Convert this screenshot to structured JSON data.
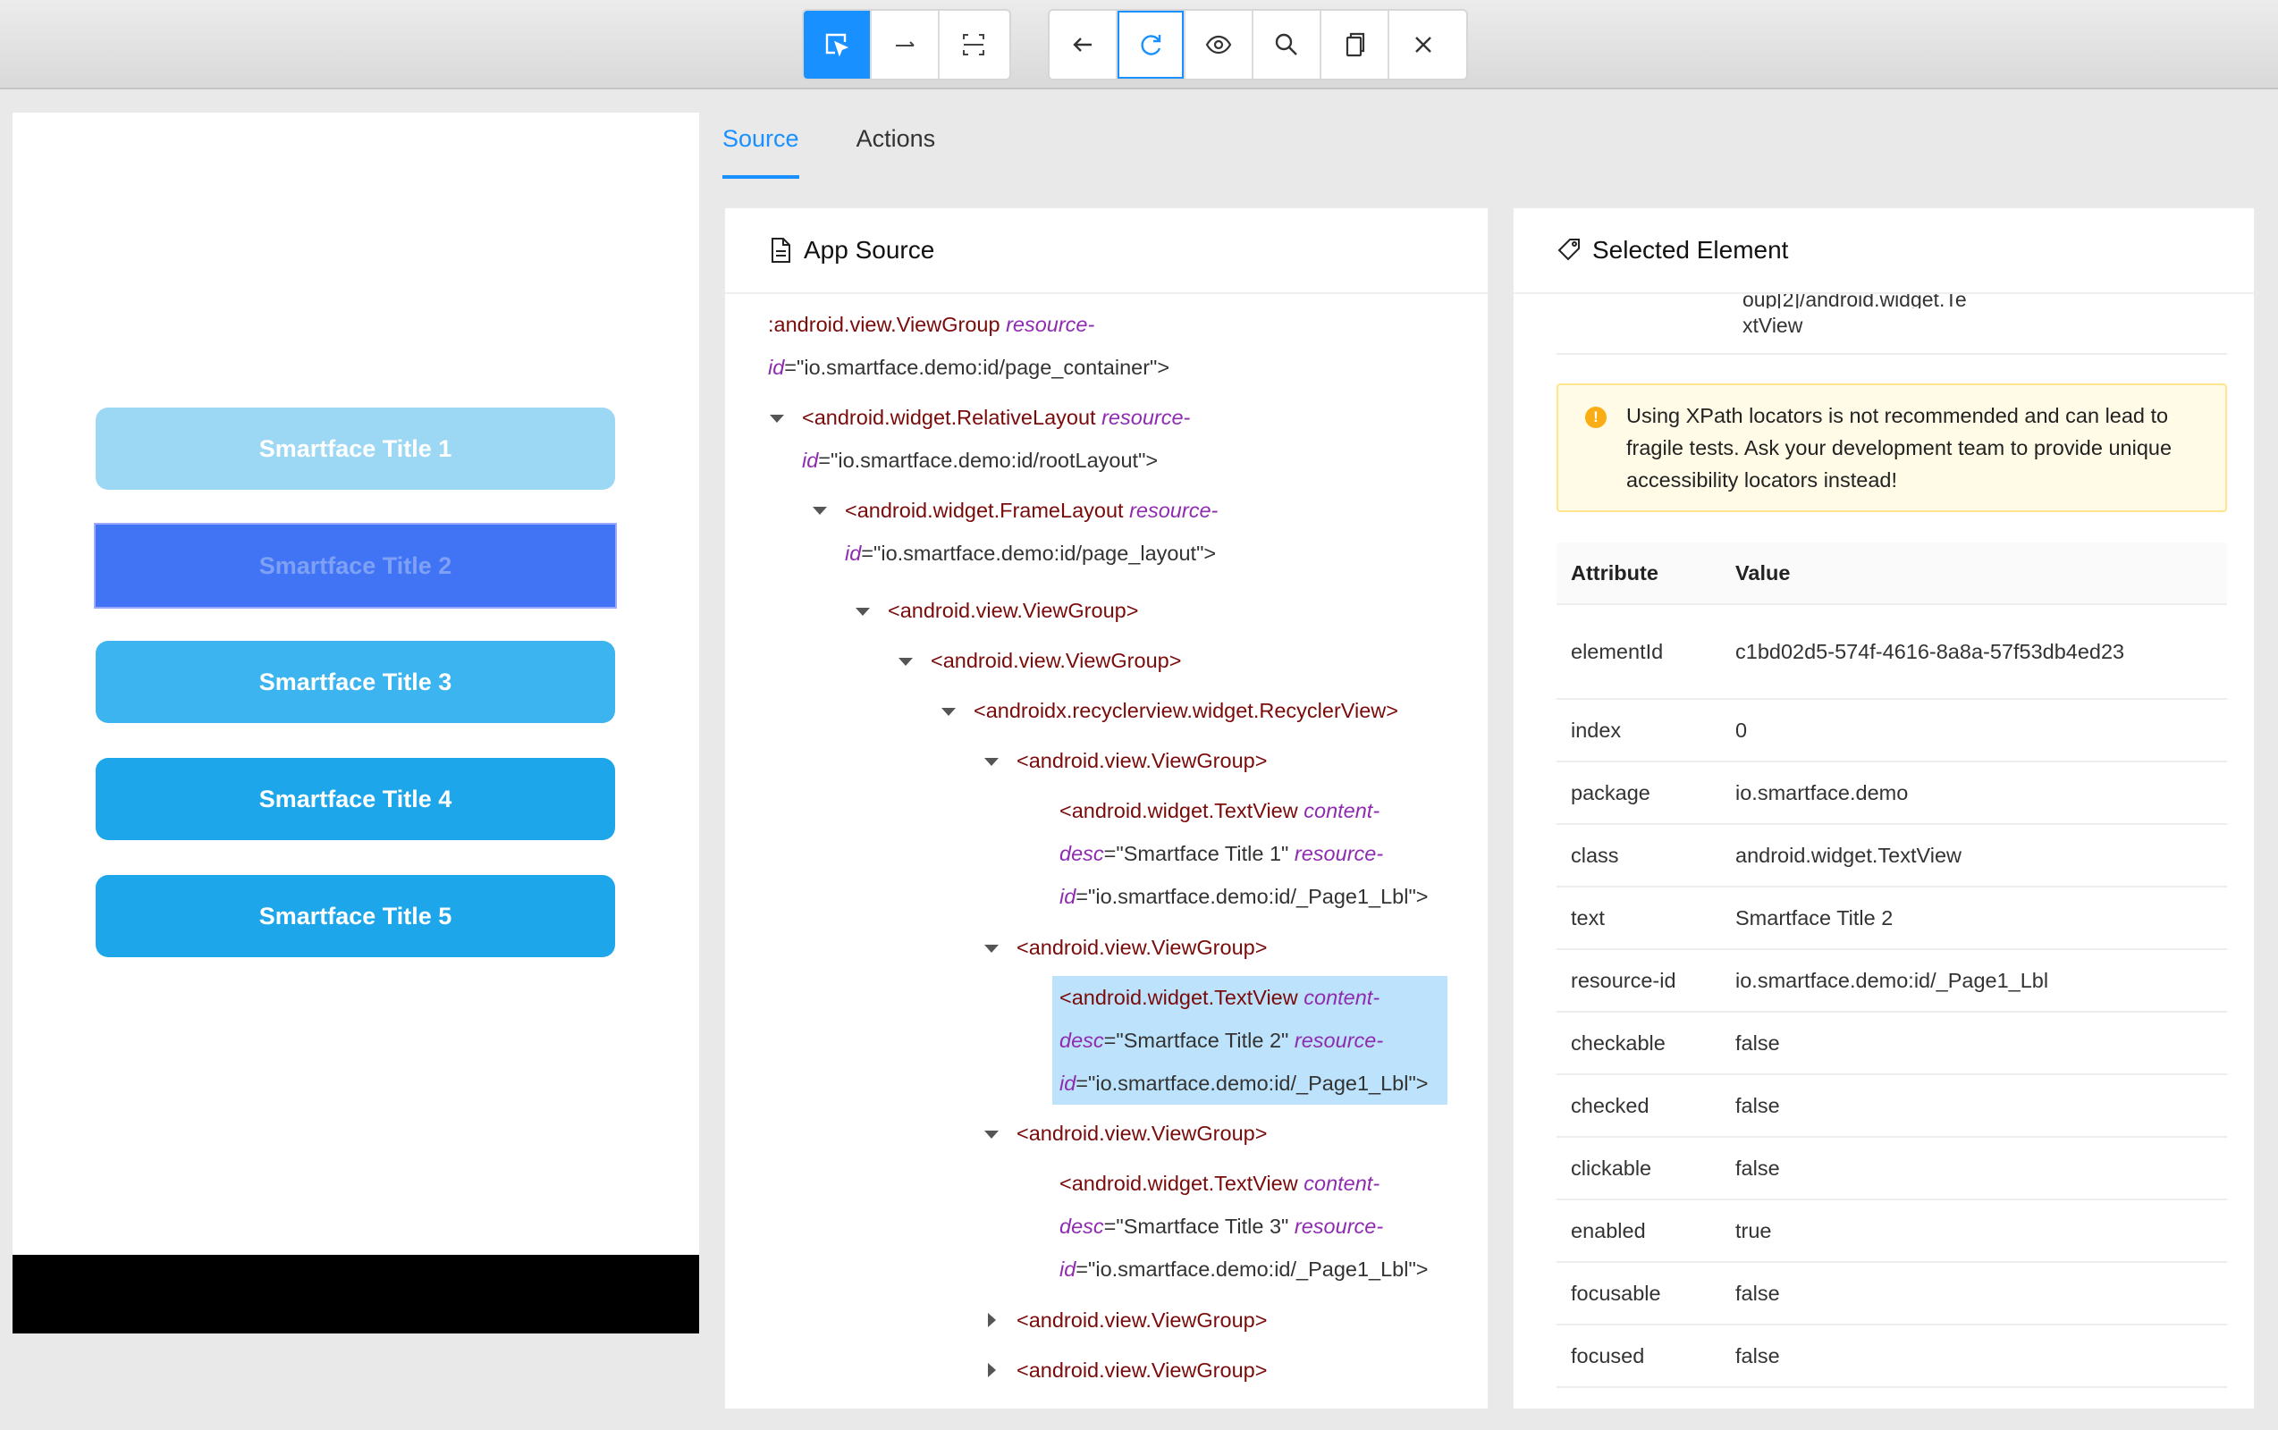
{
  "toolbar": {
    "group1": [
      {
        "icon": "select-element-icon",
        "active": true
      },
      {
        "icon": "swipe-icon"
      },
      {
        "icon": "tap-by-coordinates-icon"
      }
    ],
    "group2": [
      {
        "icon": "back-arrow-icon"
      },
      {
        "icon": "refresh-icon"
      },
      {
        "icon": "eye-icon"
      },
      {
        "icon": "search-icon"
      },
      {
        "icon": "copy-xml-icon"
      },
      {
        "icon": "close-icon"
      }
    ],
    "accent": "#1890ff"
  },
  "device": {
    "buttons": [
      "Smartface Title 1",
      "Smartface Title 2",
      "Smartface Title 3",
      "Smartface Title 4",
      "Smartface Title 5"
    ]
  },
  "tabs": {
    "source": "Source",
    "actions": "Actions"
  },
  "app_source": {
    "title": "App Source",
    "n0": {
      "tag": ":android.view.ViewGroup",
      "attr1": "resource-",
      "attr1b": "id",
      "val1": "=\"io.smartface.demo:id/page_container\">"
    },
    "n1": {
      "tag": "<android.widget.RelativeLayout",
      "attr1": "resource-",
      "attr1b": "id",
      "val1": "=\"io.smartface.demo:id/rootLayout\">"
    },
    "n2": {
      "tag": "<android.widget.FrameLayout",
      "attr1": "resource-",
      "attr1b": "id",
      "val1": "=\"io.smartface.demo:id/page_layout\">"
    },
    "n3": {
      "tag": "<android.view.ViewGroup>"
    },
    "n4": {
      "tag": "<android.view.ViewGroup>"
    },
    "n5": {
      "tag": "<androidx.recyclerview.widget.RecyclerView>"
    },
    "n6": {
      "tag": "<android.view.ViewGroup>"
    },
    "n7": {
      "tag": "<android.widget.TextView",
      "attr1": "content-",
      "attr1b": "desc",
      "val1": "=\"Smartface Title 1\"",
      "attr2": "resource-",
      "attr2b": "id",
      "val2": "=\"io.smartface.demo:id/_Page1_Lbl\">"
    },
    "n8": {
      "tag": "<android.view.ViewGroup>"
    },
    "n9": {
      "tag": "<android.widget.TextView",
      "attr1": "content-",
      "attr1b": "desc",
      "val1": "=\"Smartface Title 2\"",
      "attr2": "resource-",
      "attr2b": "id",
      "val2": "=\"io.smartface.demo:id/_Page1_Lbl\">"
    },
    "n10": {
      "tag": "<android.view.ViewGroup>"
    },
    "n11": {
      "tag": "<android.widget.TextView",
      "attr1": "content-",
      "attr1b": "desc",
      "val1": "=\"Smartface Title 3\"",
      "attr2": "resource-",
      "attr2b": "id",
      "val2": "=\"io.smartface.demo:id/_Page1_Lbl\">"
    },
    "n12": {
      "tag": "<android.view.ViewGroup>"
    },
    "n13": {
      "tag": "<android.view.ViewGroup>"
    }
  },
  "selected": {
    "title": "Selected Element",
    "xpath_cut": "oup[2]/android.widget.Te",
    "xpath_tail": "xtView",
    "warning": "Using XPath locators is not recommended and can lead to fragile tests. Ask your development team to provide unique accessibility locators instead!",
    "header": {
      "attribute": "Attribute",
      "value": "Value"
    },
    "rows": [
      {
        "k": "elementId",
        "v": "c1bd02d5-574f-4616-8a8a-57f53db4ed23"
      },
      {
        "k": "index",
        "v": "0"
      },
      {
        "k": "package",
        "v": "io.smartface.demo"
      },
      {
        "k": "class",
        "v": "android.widget.TextView"
      },
      {
        "k": "text",
        "v": "Smartface Title 2"
      },
      {
        "k": "resource-id",
        "v": "io.smartface.demo:id/_Page1_Lbl"
      },
      {
        "k": "checkable",
        "v": "false"
      },
      {
        "k": "checked",
        "v": "false"
      },
      {
        "k": "clickable",
        "v": "false"
      },
      {
        "k": "enabled",
        "v": "true"
      },
      {
        "k": "focusable",
        "v": "false"
      },
      {
        "k": "focused",
        "v": "false"
      }
    ]
  }
}
